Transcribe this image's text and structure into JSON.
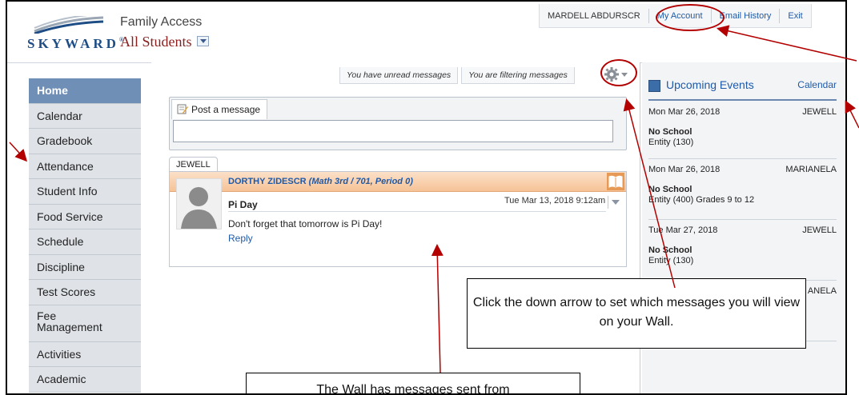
{
  "header": {
    "logo": "SKYWARD",
    "app_name": "Family Access",
    "student_selector": "All Students"
  },
  "topbar": {
    "user": "MARDELL ABDURSCR",
    "my_account": "My Account",
    "email_history": "Email History",
    "exit": "Exit"
  },
  "sidebar": {
    "items": [
      {
        "label": "Home"
      },
      {
        "label": "Calendar"
      },
      {
        "label": "Gradebook"
      },
      {
        "label": "Attendance"
      },
      {
        "label": "Student Info"
      },
      {
        "label": "Food Service"
      },
      {
        "label": "Schedule"
      },
      {
        "label": "Discipline"
      },
      {
        "label": "Test Scores"
      },
      {
        "label": "Fee Management"
      },
      {
        "label": "Activities"
      },
      {
        "label": "Academic"
      }
    ]
  },
  "filters": {
    "unread": "You have unread messages",
    "filtering": "You are filtering messages"
  },
  "post": {
    "label": "Post a message"
  },
  "message": {
    "tab": "JEWELL",
    "sender": "DORTHY ZIDESCR",
    "course": "(Math 3rd / 701, Period 0)",
    "title": "Pi Day",
    "date": "Tue Mar 13, 2018 9:12am",
    "body": "Don't forget that tomorrow is Pi Day!",
    "reply": "Reply"
  },
  "events": {
    "title": "Upcoming Events",
    "calendar_link": "Calendar",
    "items": [
      {
        "date": "Mon Mar 26, 2018",
        "student": "JEWELL",
        "title": "No School",
        "entity": "Entity (130)"
      },
      {
        "date": "Mon Mar 26, 2018",
        "student": "MARIANELA",
        "title": "No School",
        "entity": "Entity (400) Grades 9 to 12"
      },
      {
        "date": "Tue Mar 27, 2018",
        "student": "JEWELL",
        "title": "No School",
        "entity": "Entity (130)"
      },
      {
        "date": "",
        "student": "ANELA",
        "title": "",
        "entity": ""
      }
    ]
  },
  "annotations": {
    "arrow_note": "Click the down arrow to set which messages you will view on your Wall.",
    "wall_note": "The Wall has messages sent from"
  },
  "colors": {
    "annotation_red": "#b30000",
    "active_nav": "#6f8fb6",
    "link_blue": "#1f5aa8",
    "message_header": "#f6c397"
  }
}
